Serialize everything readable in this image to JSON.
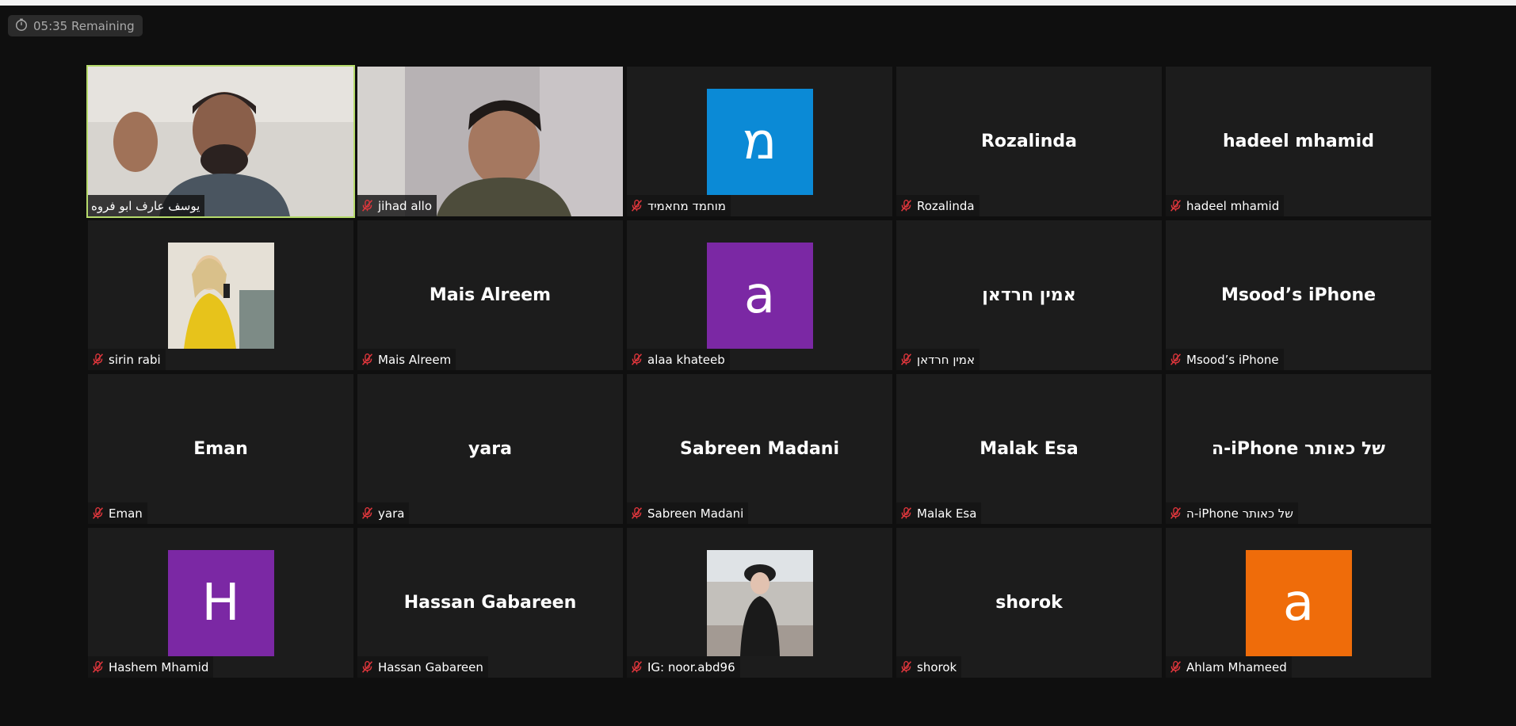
{
  "timer": {
    "text": "05:35 Remaining",
    "icon": "stopwatch-icon"
  },
  "colors": {
    "mute_red": "#e0363c",
    "active_border": "#b6db6b",
    "tile_bg": "#1c1c1c",
    "avatar_blue": "#0b8ad6",
    "avatar_purple": "#7b28a4",
    "avatar_orange": "#ef6c0a"
  },
  "participants": [
    {
      "label": "يوسف عارف ابو فروه",
      "muted": false,
      "video": true
    },
    {
      "label": "jihad allo",
      "muted": true,
      "video": true
    },
    {
      "label": "מוחמד מחאמיד",
      "muted": true,
      "avatar_letter": "מ",
      "avatar_color": "#0b8ad6"
    },
    {
      "label": "Rozalinda",
      "muted": true,
      "display_name": "Rozalinda"
    },
    {
      "label": "hadeel mhamid",
      "muted": true,
      "display_name": "hadeel mhamid"
    },
    {
      "label": "sirin rabi",
      "muted": true,
      "photo": true
    },
    {
      "label": "Mais Alreem",
      "muted": true,
      "display_name": "Mais Alreem"
    },
    {
      "label": "alaa khateeb",
      "muted": true,
      "avatar_letter": "a",
      "avatar_color": "#7b28a4"
    },
    {
      "label": "אמין חרדאן",
      "muted": true,
      "display_name": "אמין חרדאן"
    },
    {
      "label": "Msood’s iPhone",
      "muted": true,
      "display_name": "Msood’s iPhone"
    },
    {
      "label": "Eman",
      "muted": true,
      "display_name": "Eman"
    },
    {
      "label": "yara",
      "muted": true,
      "display_name": "yara"
    },
    {
      "label": "Sabreen Madani",
      "muted": true,
      "display_name": "Sabreen Madani"
    },
    {
      "label": "Malak Esa",
      "muted": true,
      "display_name": "Malak Esa"
    },
    {
      "label": "ה-iPhone של כאותר",
      "muted": true,
      "display_name": "ה-iPhone של כאותר"
    },
    {
      "label": "Hashem Mhamid",
      "muted": true,
      "avatar_letter": "H",
      "avatar_color": "#7b28a4"
    },
    {
      "label": "Hassan Gabareen",
      "muted": true,
      "display_name": "Hassan Gabareen"
    },
    {
      "label": "IG: noor.abd96",
      "muted": true,
      "photo": true
    },
    {
      "label": "shorok",
      "muted": true,
      "display_name": "shorok"
    },
    {
      "label": "Ahlam Mhameed",
      "muted": true,
      "avatar_letter": "a",
      "avatar_color": "#ef6c0a"
    }
  ]
}
